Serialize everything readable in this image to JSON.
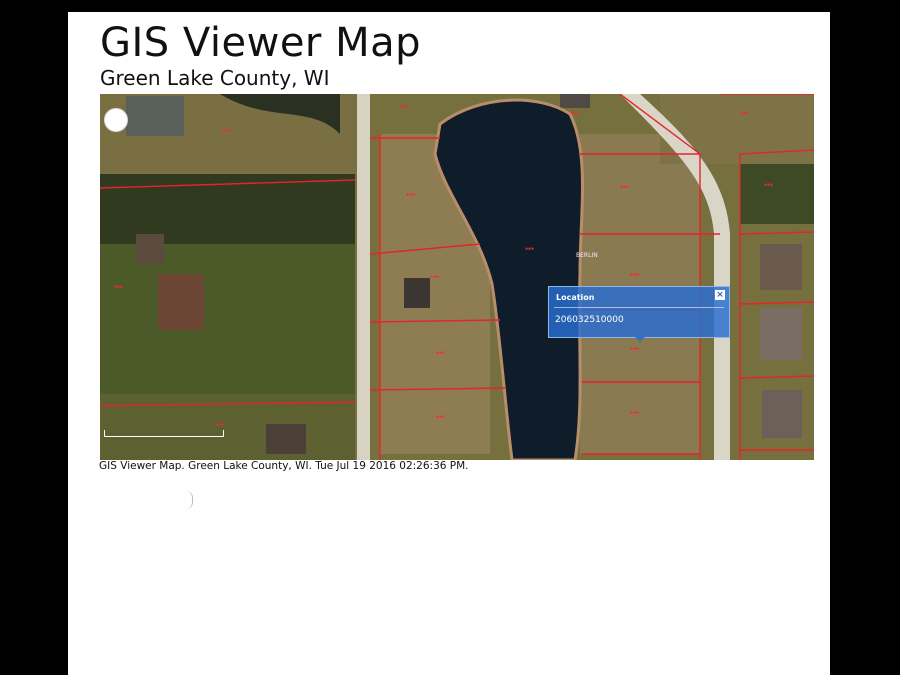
{
  "header": {
    "title": "GIS Viewer Map",
    "subtitle": "Green Lake County, WI"
  },
  "popup": {
    "title": "Location",
    "value": "206032510000",
    "close_glyph": "×"
  },
  "map": {
    "street_labels": [
      "BERLIN"
    ]
  },
  "caption": "GIS Viewer Map. Green Lake County, WI. Tue Jul 19 2016 02:26:36 PM.",
  "colors": {
    "parcel_line": "#e8232a",
    "water": "#0f1c2a",
    "road": "#d9d6c8",
    "popup_bg": "#2f6fd2"
  },
  "icons": {
    "close": "close-icon",
    "zoom": "zoom-circle-icon"
  }
}
